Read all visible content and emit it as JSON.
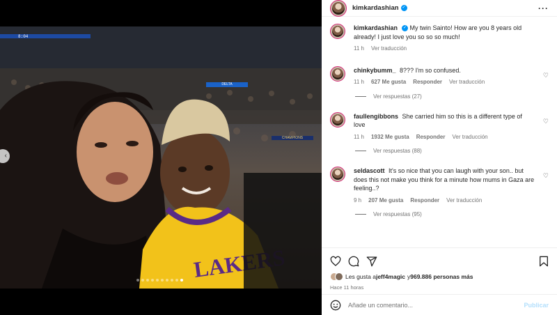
{
  "post": {
    "username": "kimkardashian",
    "verified": true,
    "caption": {
      "username": "kimkardashian",
      "text": "My twin Sainto! How are you 8 years old already! I just love you so so so much!",
      "time": "11 h",
      "translate": "Ver traducción"
    },
    "media": {
      "scoreboard_text": "8:04",
      "banner_text": "DELTA",
      "champ_text": "CHAMPIONS",
      "carousel_count": 10,
      "carousel_active_index": 9
    }
  },
  "comments": [
    {
      "username": "chinkybumm_",
      "text": "8??? I'm so confused.",
      "time": "11 h",
      "likes": "627 Me gusta",
      "reply": "Responder",
      "translate": "Ver traducción",
      "replies": "Ver respuestas (27)"
    },
    {
      "username": "faullengibbons",
      "text": "She carried him so this is a different type of love",
      "time": "11 h",
      "likes": "1932 Me gusta",
      "reply": "Responder",
      "translate": "Ver traducción",
      "replies": "Ver respuestas (88)"
    },
    {
      "username": "seldascott",
      "text": "It's so nice that you can laugh with your son.. but does this not make you think for a minute how mums in Gaza are feeling..?",
      "time": "9 h",
      "likes": "207 Me gusta",
      "reply": "Responder",
      "translate": "Ver traducción",
      "replies": "Ver respuestas (95)"
    }
  ],
  "actions": {
    "likes_prefix": "Les gusta a",
    "likes_user": "jeff4magic",
    "likes_conj": "y",
    "likes_others": "969.886 personas más",
    "timestamp": "Hace 11 horas"
  },
  "comment_box": {
    "placeholder": "Añade un comentario...",
    "publish": "Publicar"
  },
  "icons": {
    "more": "more-options-icon",
    "heart": "heart-icon",
    "comment": "comment-icon",
    "share": "share-icon",
    "bookmark": "bookmark-icon",
    "emoji": "emoji-icon",
    "verified": "verified-badge-icon"
  },
  "colors": {
    "verified": "#0095f6",
    "link_disabled": "#b2dffc",
    "secondary_text": "#737373"
  }
}
